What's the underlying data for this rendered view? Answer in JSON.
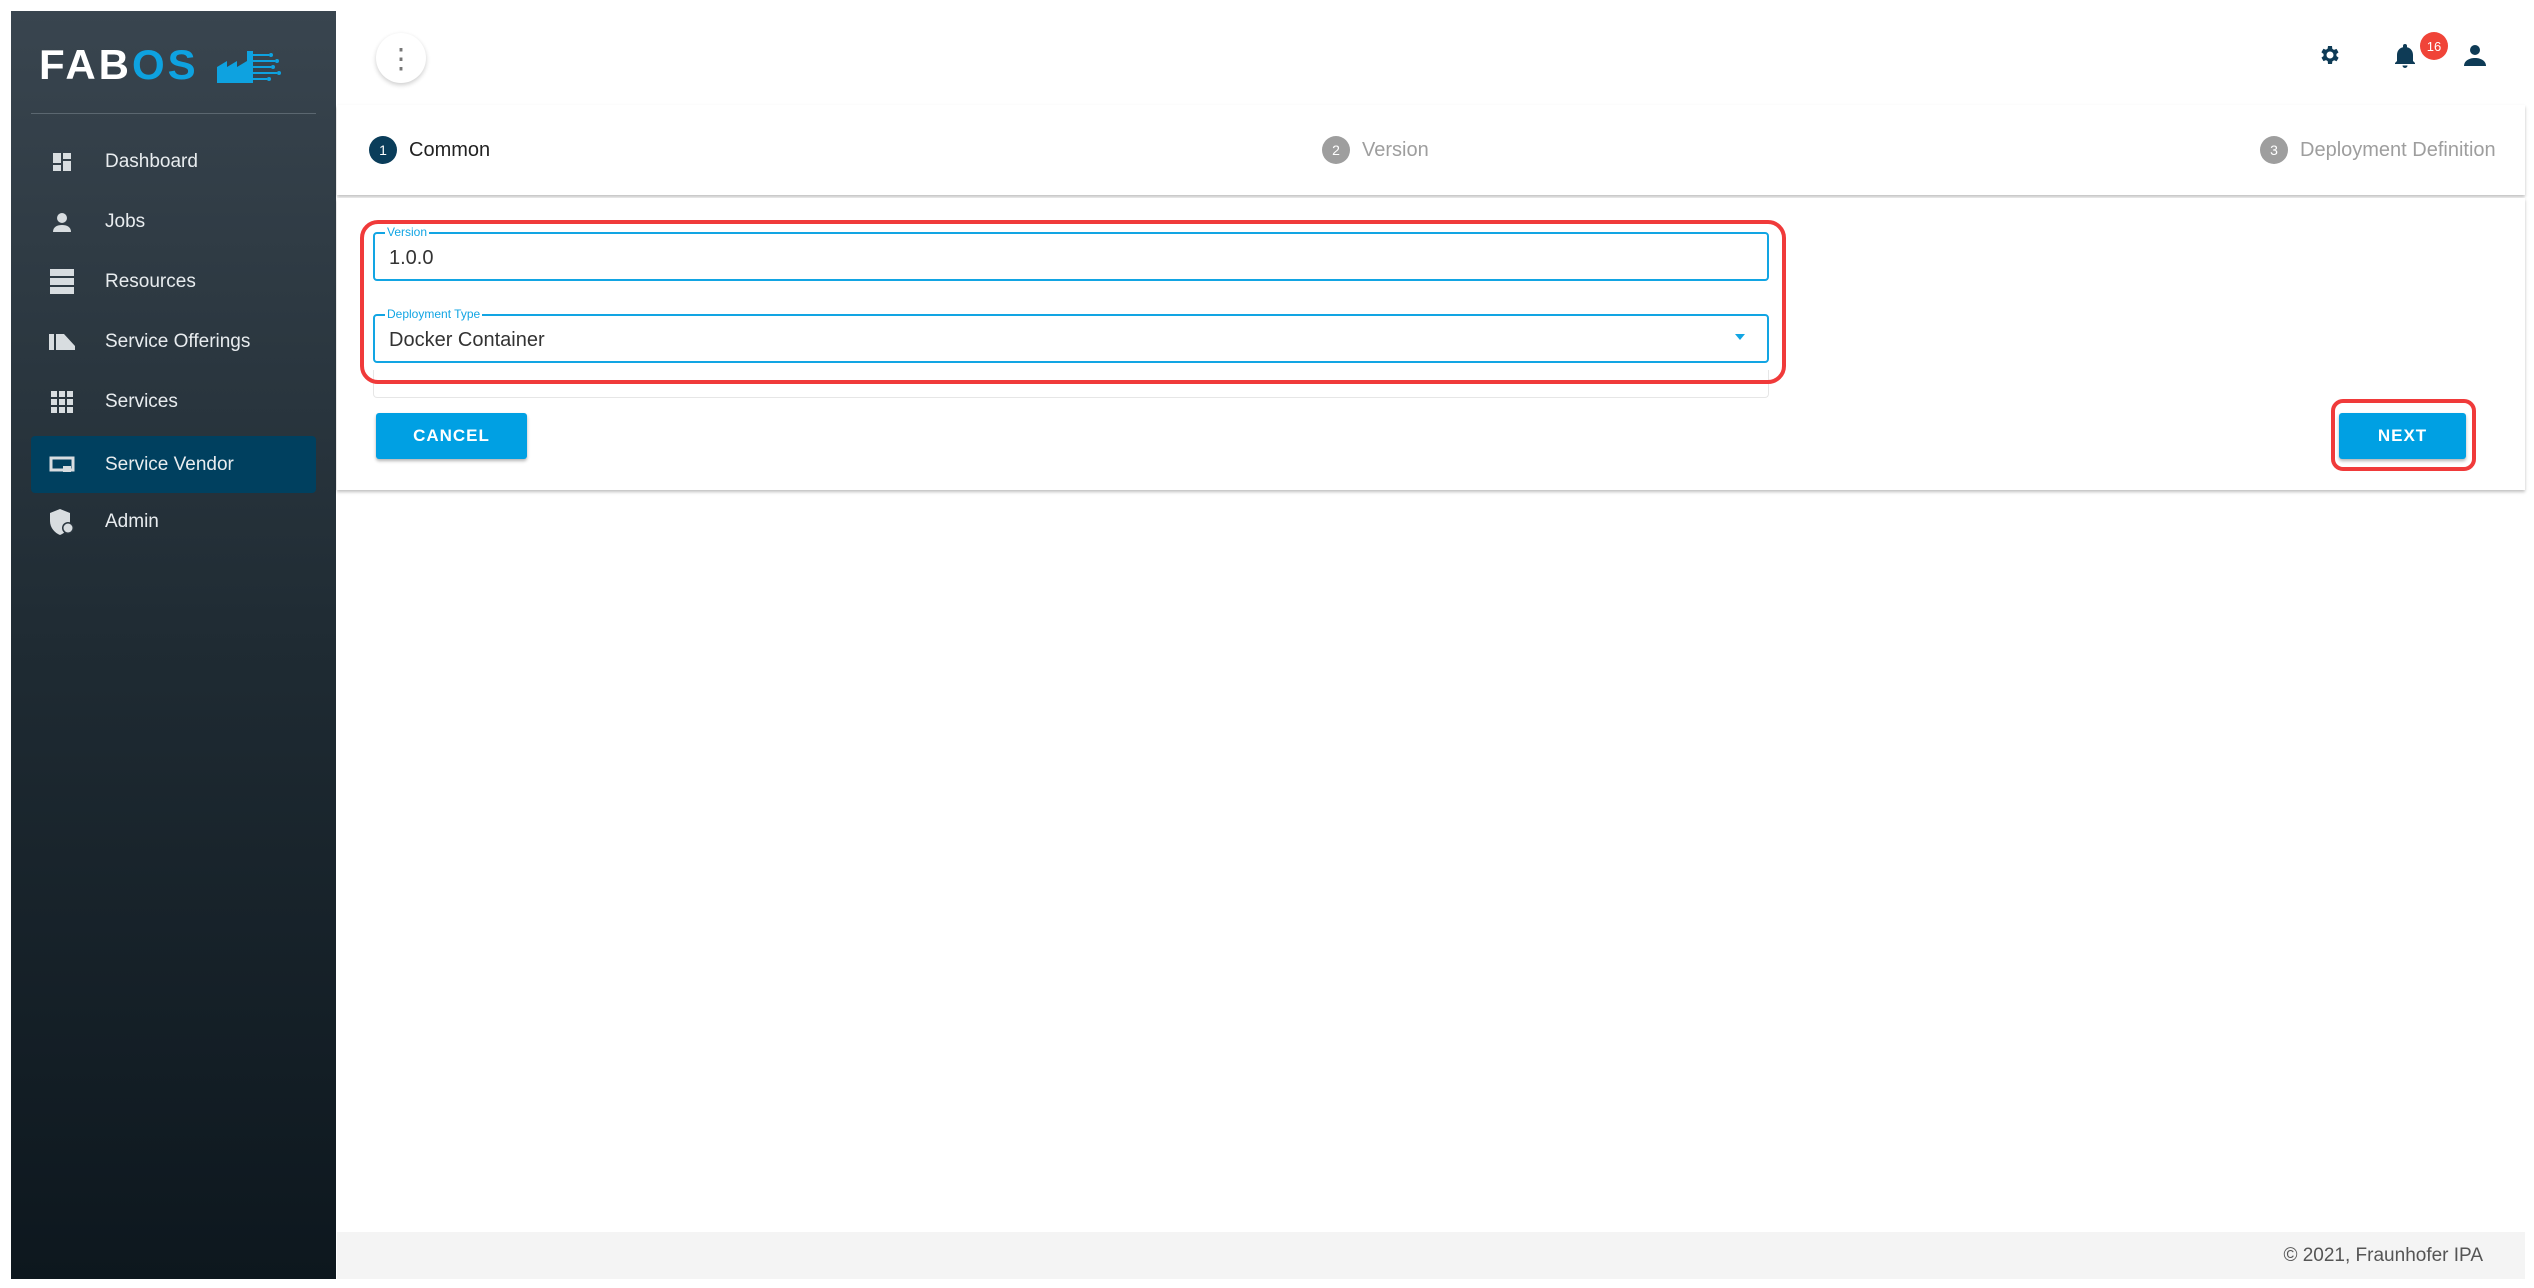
{
  "brand": {
    "logo_text_a": "FAB",
    "logo_text_b": "OS",
    "accent": "#0ea2e0"
  },
  "sidebar": {
    "items": [
      {
        "label": "Dashboard",
        "icon": "dashboard-icon"
      },
      {
        "label": "Jobs",
        "icon": "engineer-icon"
      },
      {
        "label": "Resources",
        "icon": "storage-icon"
      },
      {
        "label": "Service Offerings",
        "icon": "hand-offer-icon"
      },
      {
        "label": "Services",
        "icon": "apps-grid-icon"
      },
      {
        "label": "Service Vendor",
        "icon": "vendor-icon",
        "active": true
      },
      {
        "label": "Admin",
        "icon": "admin-shield-icon"
      }
    ]
  },
  "header": {
    "notifications_count": "16"
  },
  "stepper": {
    "steps": [
      {
        "num": "1",
        "label": "Common",
        "active": true
      },
      {
        "num": "2",
        "label": "Version"
      },
      {
        "num": "3",
        "label": "Deployment Definition"
      }
    ]
  },
  "form": {
    "version": {
      "label": "Version",
      "value": "1.0.0"
    },
    "deployment_type": {
      "label": "Deployment Type",
      "value": "Docker Container"
    },
    "cancel_label": "CANCEL",
    "next_label": "NEXT"
  },
  "footer": {
    "text": "© 2021, Fraunhofer IPA"
  }
}
